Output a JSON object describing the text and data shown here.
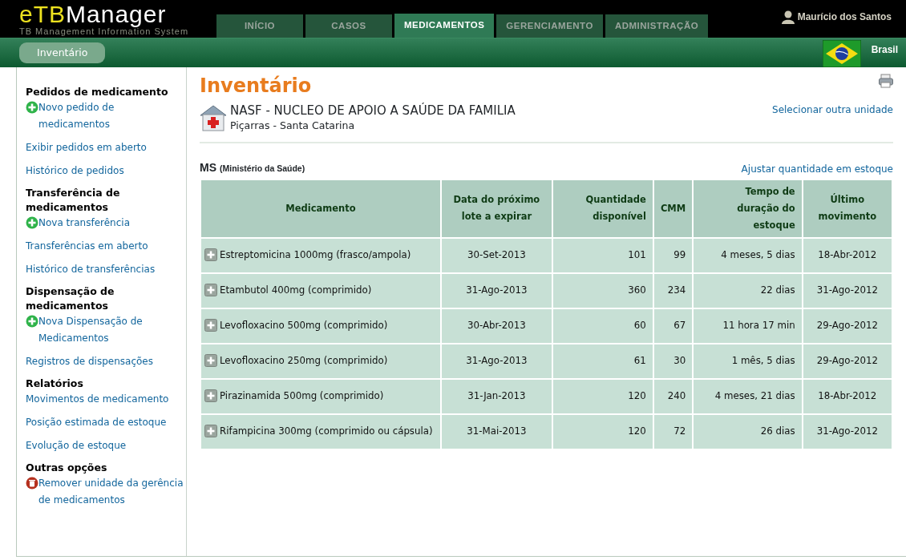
{
  "header": {
    "logo": {
      "part_1": "eTB",
      "part_2": "Manager"
    },
    "subtitle": "TB Management Information System",
    "user": "Maurício dos Santos",
    "tabs": [
      {
        "label": "INÍCIO",
        "selected": false
      },
      {
        "label": "CASOS",
        "selected": false
      },
      {
        "label": "MEDICAMENTOS",
        "selected": true
      },
      {
        "label": "GERENCIAMENTO",
        "selected": false
      },
      {
        "label": "ADMINISTRAÇÃO",
        "selected": false
      }
    ],
    "subnav": [
      "Inventário"
    ],
    "country": "Brasil"
  },
  "sidebar": {
    "sections": [
      {
        "title": "Pedidos de medicamento",
        "links": [
          {
            "label": "Novo pedido de medicamentos",
            "kind": "add"
          },
          {
            "label": "Exibir pedidos em aberto",
            "kind": "plain"
          },
          {
            "label": "Histórico de pedidos",
            "kind": "plain"
          }
        ]
      },
      {
        "title": "Transferência de medicamentos",
        "links": [
          {
            "label": "Nova transferência",
            "kind": "add"
          },
          {
            "label": "Transferências em aberto",
            "kind": "plain"
          },
          {
            "label": "Histórico de transferências",
            "kind": "plain"
          }
        ]
      },
      {
        "title": "Dispensação de medicamentos",
        "links": [
          {
            "label": "Nova Dispensação de Medicamentos",
            "kind": "add"
          },
          {
            "label": "Registros de dispensações",
            "kind": "plain"
          }
        ]
      },
      {
        "title": "Relatórios",
        "links": [
          {
            "label": "Movimentos de medicamento",
            "kind": "plain"
          },
          {
            "label": "Posição estimada de estoque",
            "kind": "plain"
          },
          {
            "label": "Evolução de estoque",
            "kind": "plain"
          }
        ]
      },
      {
        "title": "Outras opções",
        "links": [
          {
            "label": "Remover unidade da gerência de medicamentos",
            "kind": "remove"
          }
        ]
      }
    ]
  },
  "page": {
    "title": "Inventário",
    "unit": {
      "name": "NASF - NUCLEO DE APOIO A SAÚDE DA FAMILIA",
      "location": "Piçarras - Santa Catarina",
      "change_link": "Selecionar outra unidade"
    },
    "source": {
      "code": "MS",
      "name": "(Ministério da Saúde)",
      "adjust_link": "Ajustar quantidade em estoque"
    },
    "table": {
      "columns": [
        "Medicamento",
        "Data do próximo lote a expirar",
        "Quantidade disponível",
        "CMM",
        "Tempo de duração do estoque",
        "Último movimento"
      ],
      "rows": [
        [
          "Estreptomicina 1000mg (frasco/ampola)",
          "30-Set-2013",
          "101",
          "99",
          "4 meses, 5 dias",
          "18-Abr-2012"
        ],
        [
          "Etambutol 400mg (comprimido)",
          "31-Ago-2013",
          "360",
          "234",
          "22 dias",
          "31-Ago-2012"
        ],
        [
          "Levofloxacino 500mg (comprimido)",
          "30-Abr-2013",
          "60",
          "67",
          "11 hora 17 min",
          "29-Ago-2012"
        ],
        [
          "Levofloxacino 250mg (comprimido)",
          "31-Ago-2013",
          "61",
          "30",
          "1 mês, 5 dias",
          "29-Ago-2012"
        ],
        [
          "Pirazinamida 500mg (comprimido)",
          "31-Jan-2013",
          "120",
          "240",
          "4 meses, 21 dias",
          "18-Abr-2012"
        ],
        [
          "Rifampicina 300mg (comprimido ou cápsula)",
          "31-Mai-2013",
          "120",
          "72",
          "26 dias",
          "31-Ago-2012"
        ]
      ]
    }
  }
}
